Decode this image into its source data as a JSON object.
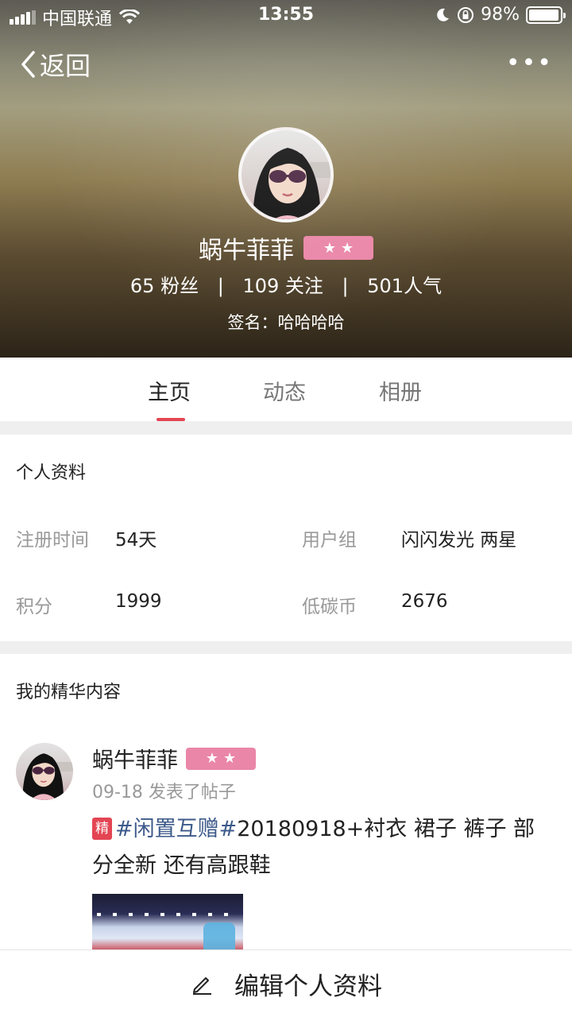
{
  "status_bar": {
    "carrier": "中国联通",
    "time": "13:55",
    "battery_percent": "98%",
    "battery_level": 0.98,
    "icons": [
      "signal-icon",
      "wifi-icon",
      "moon-icon",
      "rotation-lock-icon",
      "battery-icon"
    ]
  },
  "nav": {
    "back_label": "返回",
    "more_label": "•••"
  },
  "profile_header": {
    "username": "蜗牛菲菲",
    "level_stars": 2,
    "fans": "65 粉丝",
    "following": "109 关注",
    "popularity": "501人气",
    "separator": "|",
    "signature": "签名：哈哈哈哈"
  },
  "tabs": [
    {
      "label": "主页",
      "active": true
    },
    {
      "label": "动态",
      "active": false
    },
    {
      "label": "相册",
      "active": false
    }
  ],
  "profile_info": {
    "title": "个人资料",
    "register_time_label": "注册时间",
    "register_time_value": "54天",
    "user_group_label": "用户组",
    "user_group_value": "闪闪发光 两星",
    "points_label": "积分",
    "points_value": "1999",
    "carbon_label": "低碳币",
    "carbon_value": "2676"
  },
  "essence": {
    "title": "我的精华内容",
    "post": {
      "author": "蜗牛菲菲",
      "level_stars": 2,
      "meta": "09-18 发表了帖子",
      "tag": "精",
      "hashtag": "#闲置互赠#",
      "text": "20180918+衬衣 裙子 裤子 部分全新 还有高跟鞋"
    }
  },
  "bottom_bar": {
    "label": "编辑个人资料"
  },
  "colors": {
    "accent": "#e34553",
    "badge": "#ea86a8",
    "hashtag": "#3d5a8a"
  }
}
